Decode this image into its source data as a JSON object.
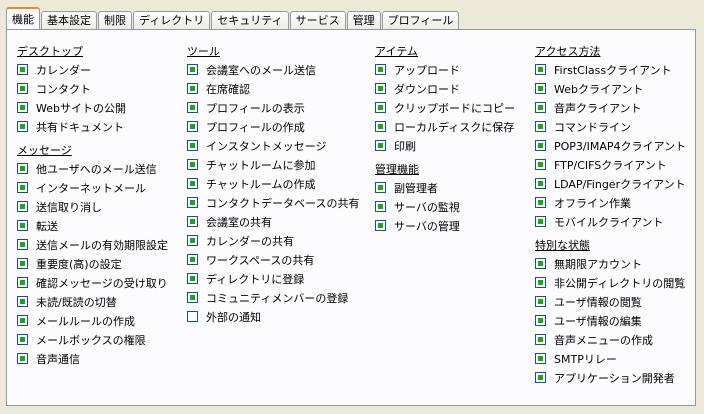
{
  "tabs": [
    {
      "label": "機能",
      "active": true
    },
    {
      "label": "基本設定",
      "active": false
    },
    {
      "label": "制限",
      "active": false
    },
    {
      "label": "ディレクトリ",
      "active": false
    },
    {
      "label": "セキュリティ",
      "active": false
    },
    {
      "label": "サービス",
      "active": false
    },
    {
      "label": "管理",
      "active": false
    },
    {
      "label": "プロフィール",
      "active": false
    }
  ],
  "columns": [
    {
      "sections": [
        {
          "title": "デスクトップ",
          "items": [
            {
              "label": "カレンダー",
              "checked": true
            },
            {
              "label": "コンタクト",
              "checked": true
            },
            {
              "label": "Webサイトの公開",
              "checked": true
            },
            {
              "label": "共有ドキュメント",
              "checked": true
            }
          ]
        },
        {
          "title": "メッセージ",
          "items": [
            {
              "label": "他ユーザへのメール送信",
              "checked": true
            },
            {
              "label": "インターネットメール",
              "checked": true
            },
            {
              "label": "送信取り消し",
              "checked": true
            },
            {
              "label": "転送",
              "checked": true
            },
            {
              "label": "送信メールの有効期限設定",
              "checked": true
            },
            {
              "label": "重要度(高)の設定",
              "checked": true
            },
            {
              "label": "確認メッセージの受け取り",
              "checked": true
            },
            {
              "label": "未読/既読の切替",
              "checked": true
            },
            {
              "label": "メールルールの作成",
              "checked": true
            },
            {
              "label": "メールボックスの権限",
              "checked": true
            },
            {
              "label": "音声通信",
              "checked": true
            }
          ]
        }
      ]
    },
    {
      "sections": [
        {
          "title": "ツール",
          "items": [
            {
              "label": "会議室へのメール送信",
              "checked": true
            },
            {
              "label": "在席確認",
              "checked": true
            },
            {
              "label": "プロフィールの表示",
              "checked": true
            },
            {
              "label": "プロフィールの作成",
              "checked": true
            },
            {
              "label": "インスタントメッセージ",
              "checked": true
            },
            {
              "label": "チャットルームに参加",
              "checked": true
            },
            {
              "label": "チャットルームの作成",
              "checked": true
            },
            {
              "label": "コンタクトデータベースの共有",
              "checked": true
            },
            {
              "label": "会議室の共有",
              "checked": true
            },
            {
              "label": "カレンダーの共有",
              "checked": true
            },
            {
              "label": "ワークスペースの共有",
              "checked": true
            },
            {
              "label": "ディレクトリに登録",
              "checked": true
            },
            {
              "label": "コミュニティメンバーの登録",
              "checked": true
            },
            {
              "label": "外部の通知",
              "checked": false
            }
          ]
        }
      ]
    },
    {
      "sections": [
        {
          "title": "アイテム",
          "items": [
            {
              "label": "アップロード",
              "checked": true
            },
            {
              "label": "ダウンロード",
              "checked": true
            },
            {
              "label": "クリップボードにコピー",
              "checked": true
            },
            {
              "label": "ローカルディスクに保存",
              "checked": true
            },
            {
              "label": "印刷",
              "checked": true
            }
          ]
        },
        {
          "title": "管理機能",
          "items": [
            {
              "label": "副管理者",
              "checked": true
            },
            {
              "label": "サーバの監視",
              "checked": true
            },
            {
              "label": "サーバの管理",
              "checked": true
            }
          ]
        }
      ]
    },
    {
      "sections": [
        {
          "title": "アクセス方法",
          "items": [
            {
              "label": "FirstClassクライアント",
              "checked": true
            },
            {
              "label": "Webクライアント",
              "checked": true
            },
            {
              "label": "音声クライアント",
              "checked": true
            },
            {
              "label": "コマンドライン",
              "checked": true
            },
            {
              "label": "POP3/IMAP4クライアント",
              "checked": true
            },
            {
              "label": "FTP/CIFSクライアント",
              "checked": true
            },
            {
              "label": "LDAP/Fingerクライアント",
              "checked": true
            },
            {
              "label": "オフライン作業",
              "checked": true
            },
            {
              "label": "モバイルクライアント",
              "checked": true
            }
          ]
        },
        {
          "title": "特別な状態",
          "items": [
            {
              "label": "無期限アカウント",
              "checked": true
            },
            {
              "label": "非公開ディレクトリの閲覧",
              "checked": true
            },
            {
              "label": "ユーザ情報の閲覧",
              "checked": true
            },
            {
              "label": "ユーザ情報の編集",
              "checked": true
            },
            {
              "label": "音声メニューの作成",
              "checked": true
            },
            {
              "label": "SMTPリレー",
              "checked": true
            },
            {
              "label": "アプリケーション開発者",
              "checked": true
            }
          ]
        }
      ]
    }
  ]
}
